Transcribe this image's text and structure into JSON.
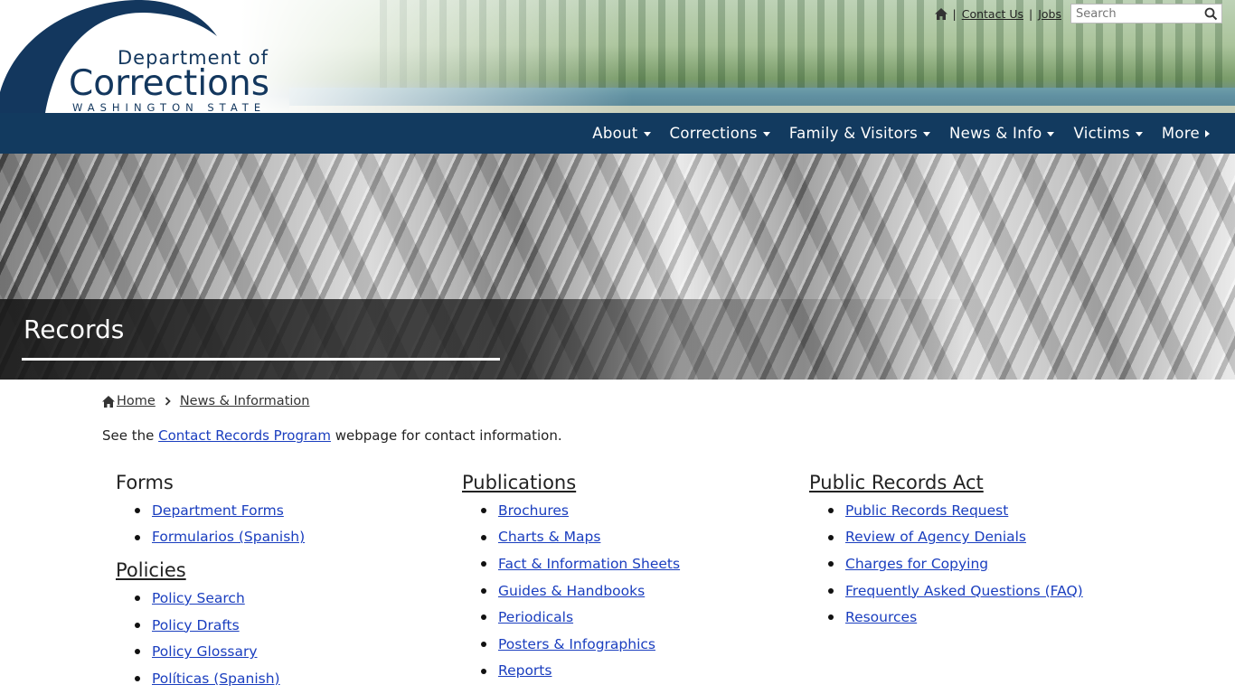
{
  "header": {
    "logo": {
      "line1": "Department of",
      "line2": "Corrections",
      "line3": "WASHINGTON STATE"
    },
    "utility": {
      "home_icon": "home-icon",
      "contact_label": "Contact Us",
      "jobs_label": "Jobs",
      "separator": "|",
      "search_placeholder": "Search",
      "search_icon": "search-icon"
    }
  },
  "nav": {
    "items": [
      {
        "label": "About",
        "icon": "caret-down-icon"
      },
      {
        "label": "Corrections",
        "icon": "caret-down-icon"
      },
      {
        "label": "Family & Visitors",
        "icon": "caret-down-icon"
      },
      {
        "label": "News & Info",
        "icon": "caret-down-icon"
      },
      {
        "label": "Victims",
        "icon": "caret-down-icon"
      },
      {
        "label": "More",
        "icon": "caret-right-icon"
      }
    ]
  },
  "banner": {
    "title": "Records"
  },
  "breadcrumb": {
    "home": "Home",
    "current": "News & Information"
  },
  "intro": {
    "before": "See the ",
    "link": "Contact Records Program",
    "after": " webpage for contact information."
  },
  "columns": {
    "forms": {
      "heading": "Forms",
      "items": [
        "Department Forms",
        "Formularios (Spanish)"
      ]
    },
    "policies": {
      "heading": "Policies",
      "items": [
        "Policy Search",
        "Policy Drafts",
        "Policy Glossary",
        "Políticas (Spanish)"
      ]
    },
    "publications": {
      "heading": "Publications",
      "items": [
        "Brochures",
        "Charts & Maps",
        "Fact & Information Sheets",
        "Guides & Handbooks",
        "Periodicals",
        "Posters & Infographics",
        "Reports"
      ]
    },
    "pra": {
      "heading": "Public Records Act",
      "items": [
        "Public Records Request",
        "Review of Agency Denials",
        "Charges for Copying",
        "Frequently Asked Questions (FAQ)",
        "Resources"
      ]
    }
  },
  "colors": {
    "nav_bg": "#123a5f",
    "logo_navy": "#13375e",
    "link": "#1a3ebf"
  }
}
